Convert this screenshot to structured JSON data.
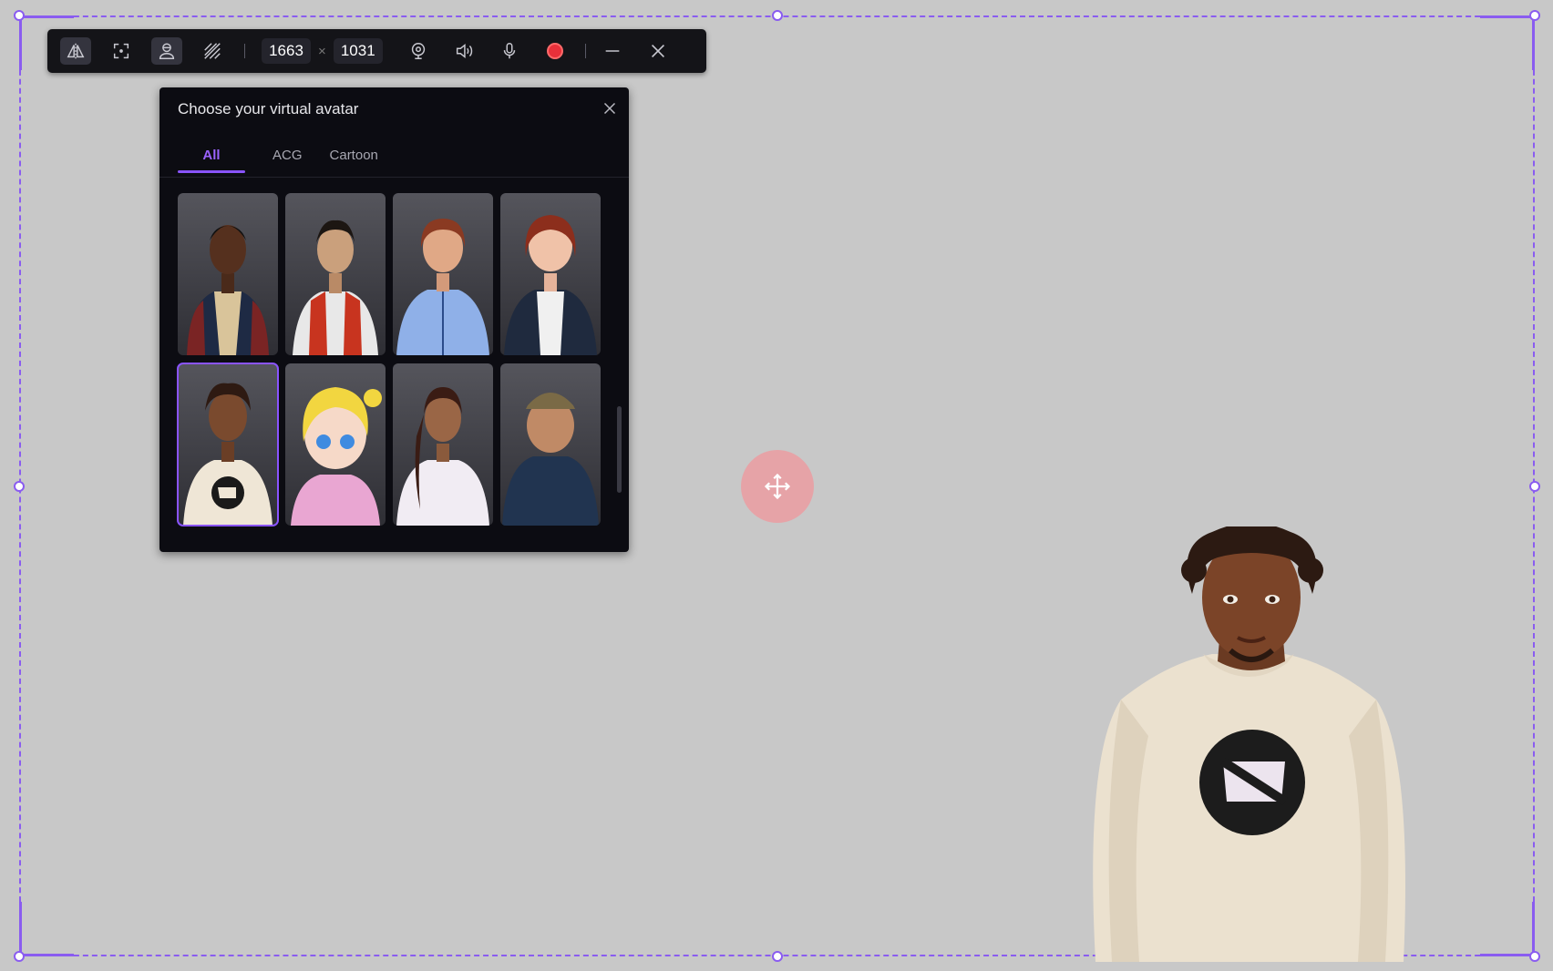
{
  "toolbar": {
    "width_value": "1663",
    "height_value": "1031",
    "separator_symbol": "×",
    "icons": [
      "mirror-icon",
      "focus-icon",
      "avatar-icon",
      "background-icon",
      "webcam-icon",
      "speaker-icon",
      "microphone-icon",
      "record-icon",
      "minimize-icon",
      "close-icon"
    ],
    "record_color": "#e8303a"
  },
  "panel": {
    "title": "Choose your virtual avatar",
    "tabs": [
      {
        "label": "All",
        "active": true
      },
      {
        "label": "ACG",
        "active": false
      },
      {
        "label": "Cartoon",
        "active": false
      }
    ],
    "avatars": [
      {
        "name": "varsity-jacket-man",
        "selected": false
      },
      {
        "name": "red-vest-boy",
        "selected": false
      },
      {
        "name": "blue-jacket-woman",
        "selected": false
      },
      {
        "name": "denim-jacket-girl",
        "selected": false
      },
      {
        "name": "sweater-man",
        "selected": true
      },
      {
        "name": "blonde-pigtail-girl",
        "selected": false
      },
      {
        "name": "hoodie-woman",
        "selected": false
      },
      {
        "name": "cap-man",
        "selected": false
      }
    ]
  },
  "accent_color": "#8a5cf0",
  "move_button": {
    "icon": "move-arrows-icon",
    "color": "#e6a3a7"
  }
}
